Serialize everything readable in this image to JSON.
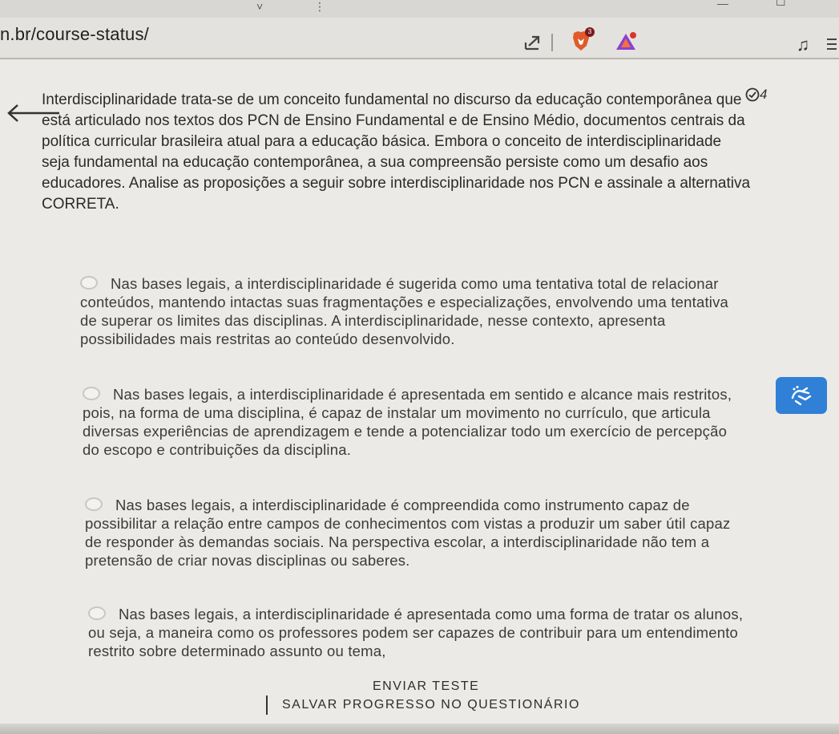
{
  "browser": {
    "url": "n.br/course-status/",
    "brave_badge": "3",
    "icons": {
      "share": "share-icon",
      "brave": "brave-shield-icon",
      "rewards": "bat-triangle-icon",
      "media": "music-note-icon",
      "menu": "hamburger-menu-icon"
    }
  },
  "question": {
    "number": "4",
    "text": "Interdisciplinaridade trata-se de um conceito fundamental no discurso da educação contemporânea que está articulado nos textos dos PCN de Ensino Fundamental e de Ensino Médio, documentos centrais da política curricular brasileira atual para a educação básica. Embora o conceito de interdisciplinaridade seja fundamental na educação contemporânea, a sua compreensão persiste como um desafio aos educadores. Analise as proposições a seguir sobre interdisciplinaridade nos PCN e assinale a alternativa CORRETA."
  },
  "options": [
    {
      "text": "Nas bases legais, a interdisciplinaridade é sugerida como uma tentativa total de relacionar conteúdos, mantendo intactas suas fragmentações e especializações, envolvendo uma tentativa de superar os limites das disciplinas. A interdisciplinaridade, nesse contexto, apresenta possibilidades mais restritas ao conteúdo desenvolvido."
    },
    {
      "text": "Nas bases legais, a interdisciplinaridade é apresentada em sentido e alcance mais restritos, pois, na forma de uma disciplina, é capaz de instalar um movimento no currículo, que articula diversas experiências de aprendizagem e tende a potencializar todo um exercício de percepção do escopo e contribuições da disciplina."
    },
    {
      "text": "Nas bases legais, a interdisciplinaridade é compreendida como instrumento capaz de possibilitar a relação entre campos de conhecimentos com vistas a produzir um saber útil capaz de responder às demandas sociais. Na perspectiva escolar, a interdisciplinaridade não tem a pretensão de criar novas disciplinas ou saberes."
    },
    {
      "text": "Nas bases legais, a interdisciplinaridade é apresentada como uma forma de tratar os alunos, ou seja, a maneira como os professores podem ser capazes de contribuir para um entendimento restrito sobre determinado assunto ou tema,"
    }
  ],
  "actions": {
    "send": "ENVIAR TESTE",
    "save": "SALVAR PROGRESSO NO QUESTIONÁRIO"
  },
  "floating_button_icon": "accessibility-hands-icon",
  "colors": {
    "accent": "#2f80d6",
    "background": "#eceae6"
  }
}
